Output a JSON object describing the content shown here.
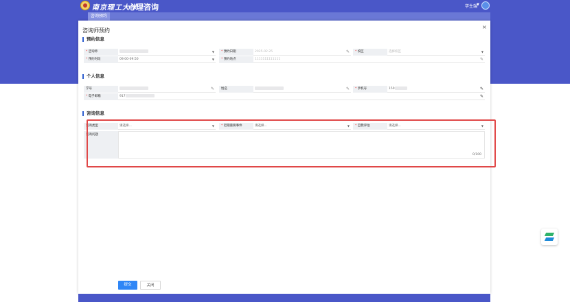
{
  "header": {
    "university_name": "南京理工大学",
    "app_title": "心理咨询",
    "user_name": "学生端",
    "active_tab": "咨询预约"
  },
  "dialog": {
    "title": "咨询师预约",
    "sections": {
      "booking": "预约信息",
      "personal": "个人信息",
      "consult": "咨询信息"
    },
    "booking": {
      "counselor_label": "咨询师",
      "date_label": "预约日期",
      "date_value": "2025-02-25",
      "campus_label": "校区",
      "campus_placeholder": "选择校区",
      "time_label": "预约时段",
      "time_value": "09:00-09:50",
      "place_label": "预约地点",
      "place_value": "1111111111111"
    },
    "personal": {
      "student_id_label": "学号",
      "name_label": "姓名",
      "phone_label": "手机号",
      "phone_prefix": "150",
      "email_label": "电子邮箱",
      "email_prefix": "917"
    },
    "consult": {
      "type_label": "咨询类型",
      "type_placeholder": "请选择...",
      "event_label": "近期重要事件",
      "event_placeholder": "请选择...",
      "risk_label": "自我评估",
      "risk_placeholder": "请选择...",
      "question_label": "咨询问题",
      "char_count": "0/100"
    },
    "buttons": {
      "submit": "提交",
      "close": "关闭"
    }
  },
  "colors": {
    "brand": "#4a57c8",
    "primary_button": "#2f86f6",
    "highlight": "#e04848"
  }
}
